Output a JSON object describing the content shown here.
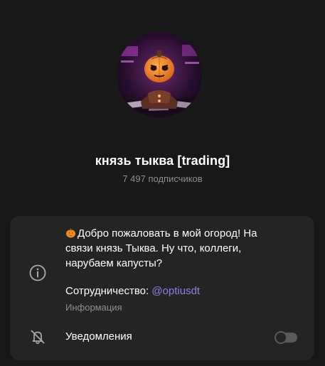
{
  "channel": {
    "title": "князь тыква [trading]",
    "subscribers": "7 497 подписчиков"
  },
  "info": {
    "description": "Добро пожаловать в мой огород! На\nсвязи князь Тыква. Ну что, коллеги,\nнарубаем капусты?",
    "description_emoji": "pumpkin-emoji",
    "cooperation_label": "Сотрудничество: ",
    "cooperation_handle": "@optiusdt",
    "section_label": "Информация"
  },
  "notifications": {
    "label": "Уведомления",
    "enabled": false
  },
  "colors": {
    "background": "#181818",
    "card": "#242424",
    "link": "#8f7fe8",
    "secondary_text": "#8e8e93"
  },
  "icons": {
    "info": "info-icon",
    "notifications": "bell-off-icon"
  }
}
